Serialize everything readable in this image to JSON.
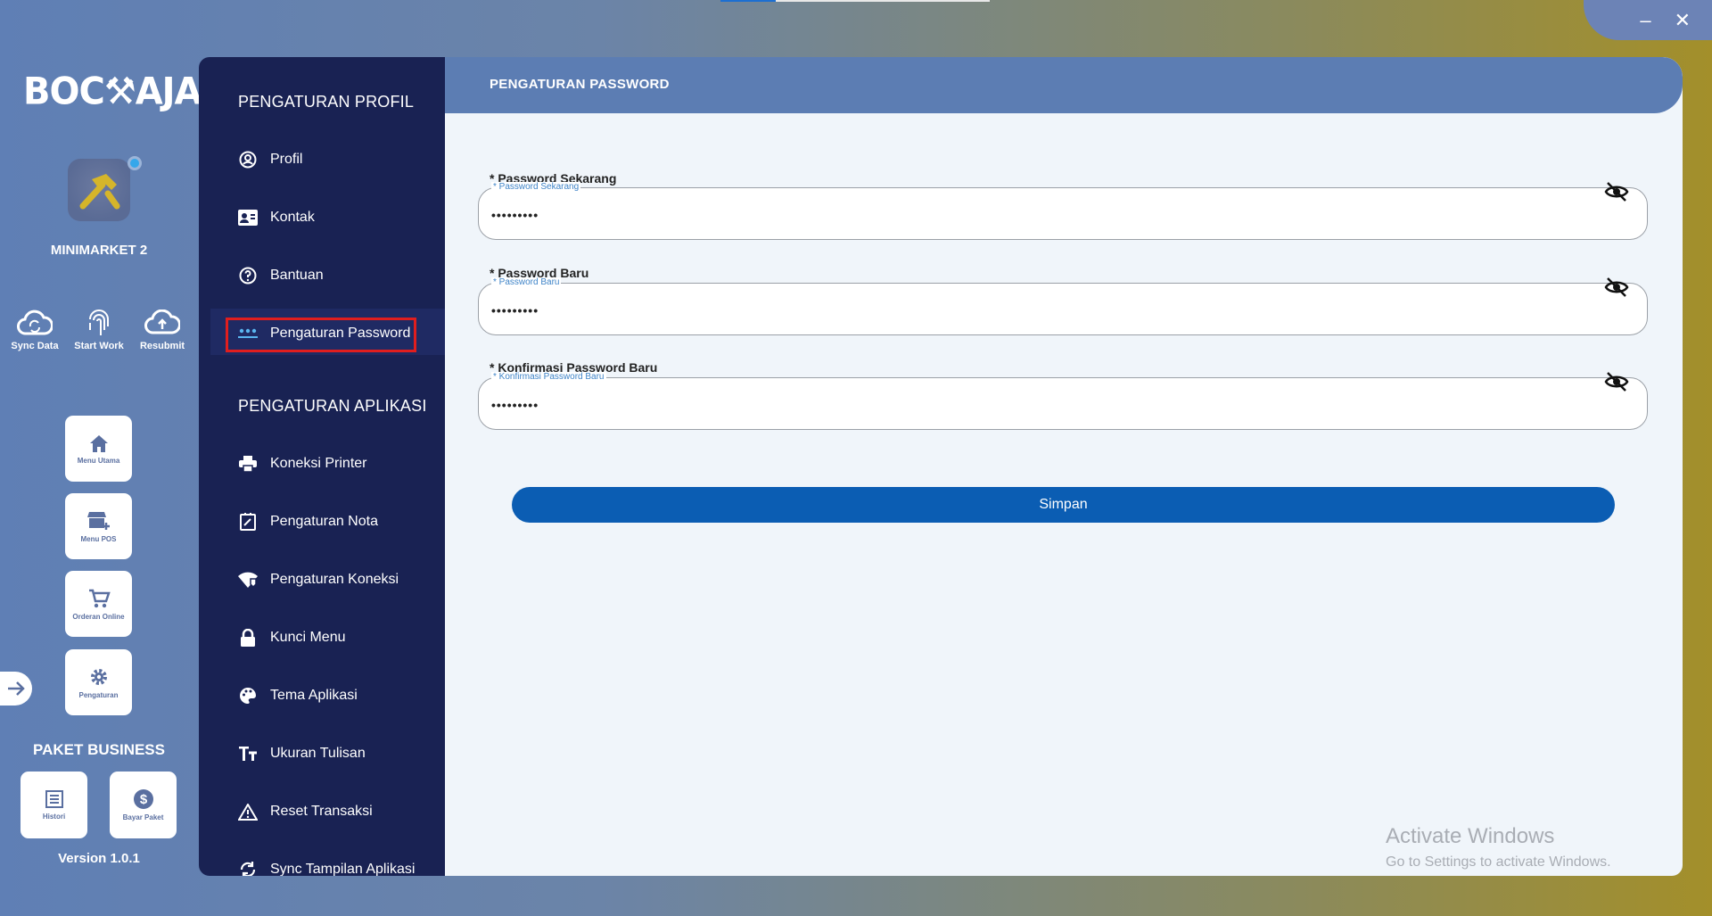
{
  "window": {
    "minimize": "–",
    "close": "✕"
  },
  "rail": {
    "logo": "BOC⚒AJA",
    "store_name": "MINIMARKET 2",
    "quick_actions": [
      {
        "label": "Sync Data",
        "icon": "cloud-sync-icon"
      },
      {
        "label": "Start Work",
        "icon": "fingerprint-icon"
      },
      {
        "label": "Resubmit",
        "icon": "cloud-upload-icon"
      }
    ],
    "tiles": [
      {
        "label": "Menu Utama",
        "icon": "home-icon"
      },
      {
        "label": "Menu POS",
        "icon": "store-add-icon"
      },
      {
        "label": "Orderan Online",
        "icon": "cart-icon"
      },
      {
        "label": "Pengaturan",
        "icon": "gear-icon"
      }
    ],
    "package_title": "PAKET BUSINESS",
    "package_tiles": [
      {
        "label": "Histori",
        "icon": "list-icon"
      },
      {
        "label": "Bayar Paket",
        "icon": "dollar-icon"
      }
    ],
    "version": "Version 1.0.1"
  },
  "nav": {
    "section_profile": "PENGATURAN PROFIL",
    "profile_items": [
      {
        "label": "Profil",
        "icon": "user-circle-icon"
      },
      {
        "label": "Kontak",
        "icon": "contact-card-icon"
      },
      {
        "label": "Bantuan",
        "icon": "help-circle-icon"
      },
      {
        "label": "Pengaturan Password",
        "icon": "password-dots-icon"
      }
    ],
    "section_app": "PENGATURAN APLIKASI",
    "app_items": [
      {
        "label": "Koneksi Printer",
        "icon": "printer-icon"
      },
      {
        "label": "Pengaturan Nota",
        "icon": "receipt-edit-icon"
      },
      {
        "label": "Pengaturan Koneksi",
        "icon": "wifi-shield-icon"
      },
      {
        "label": "Kunci Menu",
        "icon": "lock-icon"
      },
      {
        "label": "Tema Aplikasi",
        "icon": "palette-icon"
      },
      {
        "label": "Ukuran Tulisan",
        "icon": "text-size-icon"
      },
      {
        "label": "Reset Transaksi",
        "icon": "warning-icon"
      },
      {
        "label": "Sync Tampilan Aplikasi",
        "icon": "sync-icon"
      }
    ]
  },
  "main": {
    "title": "PENGATURAN PASSWORD",
    "fields": [
      {
        "label": "* Password Sekarang",
        "mini_label": "* Password Sekarang",
        "value": "•••••••••"
      },
      {
        "label": "* Password Baru",
        "mini_label": "* Password Baru",
        "value": "•••••••••"
      },
      {
        "label": "* Konfirmasi Password Baru",
        "mini_label": "* Konfirmasi Password Baru",
        "value": "•••••••••"
      }
    ],
    "save_label": "Simpan"
  },
  "watermark": {
    "line1": "Activate Windows",
    "line2": "Go to Settings to activate Windows."
  }
}
